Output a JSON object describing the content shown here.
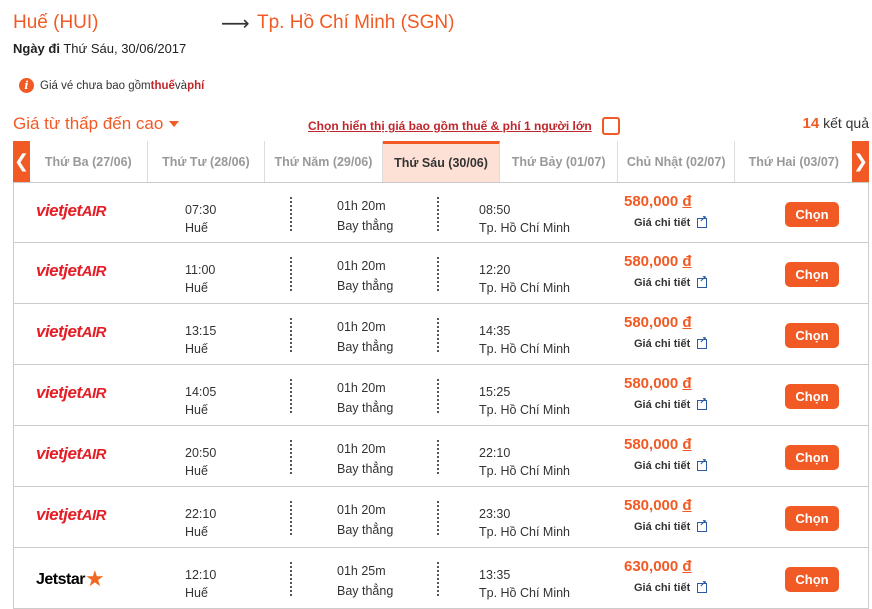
{
  "route": {
    "from": "Huế (HUI)",
    "arrow": "⟶",
    "to": "Tp. Hồ Chí Minh (SGN)"
  },
  "date_line": {
    "label": "Ngày đi",
    "value": "Thứ Sáu, 30/06/2017"
  },
  "notice": {
    "icon": "i",
    "text_before": "Giá vé chưa bao gồm ",
    "tax": "thuế",
    "and": " và ",
    "fee": "phí"
  },
  "sort": {
    "label": "Giá từ thấp đến cao",
    "tax_toggle_label": "Chọn hiển thị giá bao gồm thuế & phí 1 người lớn",
    "result_count": "14",
    "result_label": "kết quả"
  },
  "date_tabs": {
    "left_arrow": "❮",
    "right_arrow": "❯",
    "tabs": [
      {
        "label": "Thứ Ba (27/06)"
      },
      {
        "label": "Thứ Tư (28/06)"
      },
      {
        "label": "Thứ Năm (29/06)"
      },
      {
        "label": "Thứ Sáu (30/06)"
      },
      {
        "label": "Thứ Bảy (01/07)"
      },
      {
        "label": "Chủ Nhật (02/07)"
      },
      {
        "label": "Thứ Hai (03/07)"
      }
    ],
    "active_index": 3
  },
  "flights": [
    {
      "airline": "vietjet",
      "logo_main": "vietjet",
      "logo_air": "AIR",
      "dep_time": "07:30",
      "dep_city": "Huế",
      "duration": "01h 20m",
      "stops": "Bay thẳng",
      "arr_time": "08:50",
      "arr_city": "Tp. Hồ Chí Minh",
      "price": "580,000",
      "currency": "đ",
      "detail": "Giá chi tiết",
      "choose": "Chọn"
    },
    {
      "airline": "vietjet",
      "logo_main": "vietjet",
      "logo_air": "AIR",
      "dep_time": "11:00",
      "dep_city": "Huế",
      "duration": "01h 20m",
      "stops": "Bay thẳng",
      "arr_time": "12:20",
      "arr_city": "Tp. Hồ Chí Minh",
      "price": "580,000",
      "currency": "đ",
      "detail": "Giá chi tiết",
      "choose": "Chọn"
    },
    {
      "airline": "vietjet",
      "logo_main": "vietjet",
      "logo_air": "AIR",
      "dep_time": "13:15",
      "dep_city": "Huế",
      "duration": "01h 20m",
      "stops": "Bay thẳng",
      "arr_time": "14:35",
      "arr_city": "Tp. Hồ Chí Minh",
      "price": "580,000",
      "currency": "đ",
      "detail": "Giá chi tiết",
      "choose": "Chọn"
    },
    {
      "airline": "vietjet",
      "logo_main": "vietjet",
      "logo_air": "AIR",
      "dep_time": "14:05",
      "dep_city": "Huế",
      "duration": "01h 20m",
      "stops": "Bay thẳng",
      "arr_time": "15:25",
      "arr_city": "Tp. Hồ Chí Minh",
      "price": "580,000",
      "currency": "đ",
      "detail": "Giá chi tiết",
      "choose": "Chọn"
    },
    {
      "airline": "vietjet",
      "logo_main": "vietjet",
      "logo_air": "AIR",
      "dep_time": "20:50",
      "dep_city": "Huế",
      "duration": "01h 20m",
      "stops": "Bay thẳng",
      "arr_time": "22:10",
      "arr_city": "Tp. Hồ Chí Minh",
      "price": "580,000",
      "currency": "đ",
      "detail": "Giá chi tiết",
      "choose": "Chọn"
    },
    {
      "airline": "vietjet",
      "logo_main": "vietjet",
      "logo_air": "AIR",
      "dep_time": "22:10",
      "dep_city": "Huế",
      "duration": "01h 20m",
      "stops": "Bay thẳng",
      "arr_time": "23:30",
      "arr_city": "Tp. Hồ Chí Minh",
      "price": "580,000",
      "currency": "đ",
      "detail": "Giá chi tiết",
      "choose": "Chọn"
    },
    {
      "airline": "jetstar",
      "logo_main": "Jetstar",
      "logo_air": "★",
      "dep_time": "12:10",
      "dep_city": "Huế",
      "duration": "01h 25m",
      "stops": "Bay thẳng",
      "arr_time": "13:35",
      "arr_city": "Tp. Hồ Chí Minh",
      "price": "630,000",
      "currency": "đ",
      "detail": "Giá chi tiết",
      "choose": "Chọn"
    }
  ],
  "colors": {
    "accent": "#f15a24",
    "price": "#f15a24",
    "tax_link": "#c0272d",
    "vietjet": "#e41e26",
    "active_tab_bg": "#fde1d6"
  }
}
